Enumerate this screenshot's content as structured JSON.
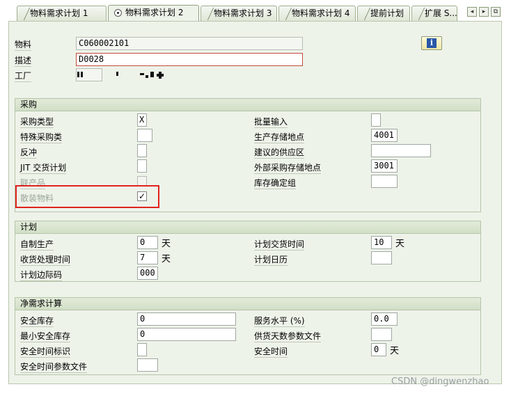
{
  "tabs": [
    {
      "label": "物料需求计划 1"
    },
    {
      "label": "物料需求计划 2"
    },
    {
      "label": "物料需求计划 3"
    },
    {
      "label": "物料需求计划 4"
    },
    {
      "label": "提前计划"
    },
    {
      "label": "扩展 S..."
    }
  ],
  "tab_nav": [
    "◂",
    "▸",
    "⧉"
  ],
  "header": {
    "material_label": "物料",
    "material_value": "C060002101",
    "description_label": "描述",
    "description_value": "D0028",
    "plant_label": "工厂"
  },
  "procurement": {
    "title": "采购",
    "procurement_type_label": "采购类型",
    "procurement_type_value": "X",
    "special_procurement_label": "特殊采购类",
    "special_procurement_value": "",
    "backflush_label": "反冲",
    "backflush_value": "",
    "jit_label": "JIT 交货计划",
    "jit_value": "",
    "coproduct_label": "联产品",
    "bulk_label": "散装物料",
    "bulk_checked": "✓",
    "batch_entry_label": "批量输入",
    "batch_entry_value": "",
    "prod_storage_label": "生产存储地点",
    "prod_storage_value": "4001",
    "supply_area_label": "建议的供应区",
    "supply_area_value": "",
    "ext_storage_label": "外部采购存储地点",
    "ext_storage_value": "3001",
    "stock_det_label": "库存确定组",
    "stock_det_value": ""
  },
  "planning": {
    "title": "计划",
    "inhouse_label": "自制生产",
    "inhouse_value": "0",
    "inhouse_unit": "天",
    "gr_time_label": "收货处理时间",
    "gr_time_value": "7",
    "gr_time_unit": "天",
    "sm_key_label": "计划边际码",
    "sm_key_value": "000",
    "planned_delivery_label": "计划交货时间",
    "planned_delivery_value": "10",
    "planned_delivery_unit": "天",
    "calendar_label": "计划日历",
    "calendar_value": ""
  },
  "net_req": {
    "title": "净需求计算",
    "safety_stock_label": "安全库存",
    "safety_stock_value": "0",
    "min_safety_label": "最小安全库存",
    "min_safety_value": "0",
    "safety_time_ind_label": "安全时间标识",
    "safety_time_ind_value": "",
    "safety_time_profile_label": "安全时间参数文件",
    "safety_time_profile_value": "",
    "service_level_label": "服务水平 (%)",
    "service_level_value": "0.0",
    "coverage_profile_label": "供货天数参数文件",
    "coverage_profile_value": "",
    "safety_time_label": "安全时间",
    "safety_time_value": "0",
    "safety_time_unit": "天"
  },
  "watermark": "CSDN @dingwenzhao"
}
